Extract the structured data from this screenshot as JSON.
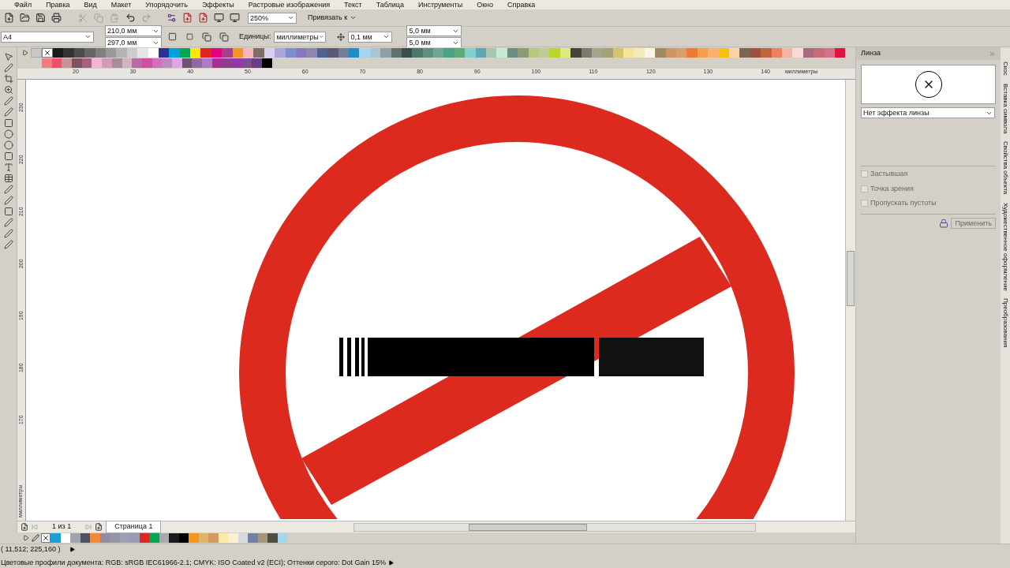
{
  "menu": [
    "Файл",
    "Правка",
    "Вид",
    "Макет",
    "Упорядочить",
    "Эффекты",
    "Растровые изображения",
    "Текст",
    "Таблица",
    "Инструменты",
    "Окно",
    "Справка"
  ],
  "toolbar": {
    "zoom": "250%",
    "snap": "Привязать к"
  },
  "property_bar": {
    "page_size": "A4",
    "width": "210,0 мм",
    "height": "297,0 мм",
    "units_label": "Единицы:",
    "units": "миллиметры",
    "nudge": "0,1 мм",
    "dup_x": "5,0 мм",
    "dup_y": "5,0 мм"
  },
  "palette_top": {
    "row1": [
      {
        "color": "#1a1a1a"
      },
      {
        "color": "#333333"
      },
      {
        "color": "#4d4d4d"
      },
      {
        "color": "#666666"
      },
      {
        "color": "#808080"
      },
      {
        "color": "#999999"
      },
      {
        "color": "#b3b3b3"
      },
      {
        "color": "#cccccc"
      },
      {
        "color": "#e6e6e6"
      },
      {
        "color": "#ffffff"
      },
      {
        "color": "#2e3192"
      },
      {
        "color": "#00a0e0"
      },
      {
        "color": "#00a651"
      },
      {
        "color": "#ffe600"
      },
      {
        "color": "#e2261f"
      },
      {
        "color": "#e5007e"
      },
      {
        "color": "#a3418b"
      },
      {
        "color": "#f7941d"
      },
      {
        "color": "#f9b6b8"
      },
      {
        "color": "#7d6e67"
      },
      {
        "color": "#d8d1ec"
      },
      {
        "color": "#ada4da"
      },
      {
        "color": "#7d8ecf"
      },
      {
        "color": "#8a78bf"
      },
      {
        "color": "#8d89ae"
      },
      {
        "color": "#4e6391"
      },
      {
        "color": "#5a5873"
      },
      {
        "color": "#707e9c"
      },
      {
        "color": "#1f8ec2"
      },
      {
        "color": "#a6d6ef"
      },
      {
        "color": "#a9c4d3"
      },
      {
        "color": "#8fa0a9"
      },
      {
        "color": "#5f7070"
      },
      {
        "color": "#3c4e4b"
      },
      {
        "color": "#4d7769"
      },
      {
        "color": "#5e917e"
      },
      {
        "color": "#6ea797"
      },
      {
        "color": "#49a383"
      },
      {
        "color": "#5eab78"
      },
      {
        "color": "#7fd0cf"
      },
      {
        "color": "#5fa6b6"
      },
      {
        "color": "#a8c5b3"
      },
      {
        "color": "#c5ecd0"
      },
      {
        "color": "#6d8d83"
      },
      {
        "color": "#8c9a78"
      },
      {
        "color": "#b7c77c"
      },
      {
        "color": "#bdcb94"
      },
      {
        "color": "#bbd52b"
      },
      {
        "color": "#dce97e"
      },
      {
        "color": "#444538"
      },
      {
        "color": "#7c7c6d"
      },
      {
        "color": "#a6a48f"
      },
      {
        "color": "#a6a177"
      },
      {
        "color": "#d4c56d"
      },
      {
        "color": "#f5e39b"
      },
      {
        "color": "#f5eab9"
      },
      {
        "color": "#fbf5e6"
      },
      {
        "color": "#a08a63"
      },
      {
        "color": "#d19362"
      },
      {
        "color": "#d89f6e"
      },
      {
        "color": "#f07a35"
      },
      {
        "color": "#f5a04c"
      },
      {
        "color": "#f9b070"
      },
      {
        "color": "#f4c20d"
      },
      {
        "color": "#fbd3a2"
      },
      {
        "color": "#7a6653"
      },
      {
        "color": "#9b5240"
      },
      {
        "color": "#c0673a"
      },
      {
        "color": "#ed8060"
      },
      {
        "color": "#f4b4a2"
      },
      {
        "color": "#f6dcd4"
      },
      {
        "color": "#a76a7e"
      },
      {
        "color": "#c96a79"
      },
      {
        "color": "#d4708b"
      },
      {
        "color": "#e0153f"
      }
    ],
    "row2": [
      {
        "color": "#f47b7b"
      },
      {
        "color": "#ee4f6e"
      },
      {
        "color": "#c99296"
      },
      {
        "color": "#7d5166"
      },
      {
        "color": "#a7617f"
      },
      {
        "color": "#f3b4d3"
      },
      {
        "color": "#d399b9"
      },
      {
        "color": "#a68d9b"
      },
      {
        "color": "#d4b2c4"
      },
      {
        "color": "#bc6aa4"
      },
      {
        "color": "#cc4fa3"
      },
      {
        "color": "#d36ec0"
      },
      {
        "color": "#b78cc3"
      },
      {
        "color": "#dea6e8"
      },
      {
        "color": "#6c5274"
      },
      {
        "color": "#8f6aa5"
      },
      {
        "color": "#ae7bc7"
      },
      {
        "color": "#aa2d96"
      },
      {
        "color": "#8c3f8d"
      },
      {
        "color": "#9537a6"
      },
      {
        "color": "#7e4e94"
      },
      {
        "color": "#6b3b86"
      },
      {
        "color": "#000000"
      }
    ]
  },
  "rulers": {
    "horizontal": [
      "20",
      "30",
      "40",
      "50",
      "60",
      "70",
      "80",
      "90",
      "100",
      "110",
      "120",
      "130",
      "140"
    ],
    "horizontal_unit": "миллиметры",
    "vertical": [
      "230",
      "220",
      "210",
      "200",
      "190",
      "180",
      "170"
    ],
    "vertical_unit": "миллиметры"
  },
  "page_nav": {
    "counter": "1 из 1",
    "tab": "Страница 1"
  },
  "docker_palette": [
    {
      "color": "#1aa0d6"
    },
    {
      "color": "#ffffff"
    },
    {
      "color": "#a0a4ad"
    },
    {
      "color": "#4f5064"
    },
    {
      "color": "#f08a3a"
    },
    {
      "color": "#8e8ba2"
    },
    {
      "color": "#9493a8"
    },
    {
      "color": "#9da0b5"
    },
    {
      "color": "#9a9cb4"
    },
    {
      "color": "#e2261f"
    },
    {
      "color": "#00a651"
    },
    {
      "color": "#a8a8b0"
    },
    {
      "color": "#1a1a1a"
    },
    {
      "color": "#000000"
    },
    {
      "color": "#f7941d"
    },
    {
      "color": "#ddb56b"
    },
    {
      "color": "#d59a64"
    },
    {
      "color": "#fbe9a6"
    },
    {
      "color": "#fbf1d0"
    },
    {
      "color": "#d7dadc"
    },
    {
      "color": "#6d83a0"
    },
    {
      "color": "#a69578"
    },
    {
      "color": "#4e4e42"
    },
    {
      "color": "#a6d6ef"
    }
  ],
  "status": {
    "coords": "( 11,512; 225,160 )",
    "profiles": "Цветовые профили документа: RGB: sRGB IEC61966-2.1; CMYK: ISO Coated v2 (ECI); Оттенки серого: Dot Gain 15%"
  },
  "docker": {
    "title": "Линза",
    "lens_type": "Нет эффекта линзы",
    "options": [
      {
        "label": "Застывшая",
        "checked": false,
        "disabled": true
      },
      {
        "label": "Точка зрения",
        "checked": false,
        "disabled": true
      },
      {
        "label": "Пропускать пустоты",
        "checked": false,
        "disabled": true
      }
    ],
    "apply": {
      "label": "Применить",
      "disabled": true
    }
  },
  "side_tabs": [
    "Скос",
    "Вставка символа",
    "Свойства объекта",
    "Художественное оформление",
    "Преобразования"
  ]
}
